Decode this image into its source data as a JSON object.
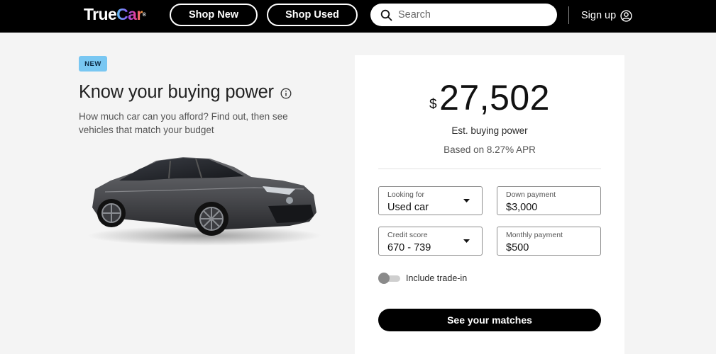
{
  "header": {
    "logo": {
      "part1": "True",
      "part2": "Car",
      "mark": "®"
    },
    "shop_new_label": "Shop New",
    "shop_used_label": "Shop Used",
    "search_placeholder": "Search",
    "sign_up_label": "Sign up",
    "icons": {
      "search": "search-icon",
      "account": "user-circle-icon"
    }
  },
  "hero": {
    "badge": "NEW",
    "title": "Know your buying power",
    "info_icon": "info-icon",
    "subtitle": "How much car can you afford? Find out, then see vehicles that match your budget",
    "image": "dark-gray-sedan-car-image"
  },
  "calculator": {
    "currency_symbol": "$",
    "amount": "27,502",
    "est_label": "Est. buying power",
    "apr_text": "Based on 8.27% APR",
    "fields": {
      "looking_for": {
        "label": "Looking for",
        "value": "Used car"
      },
      "down_payment": {
        "label": "Down payment",
        "value": "$3,000"
      },
      "credit_score": {
        "label": "Credit score",
        "value": "670 - 739"
      },
      "monthly_payment": {
        "label": "Monthly payment",
        "value": "$500"
      }
    },
    "trade_in": {
      "label": "Include trade-in",
      "enabled": false
    },
    "cta_label": "See your matches"
  },
  "colors": {
    "header_bg": "#000000",
    "page_bg": "#f4f4f4",
    "card_bg": "#ffffff",
    "badge_bg": "#79c7f2",
    "cta_bg": "#000000",
    "brand_gradient": [
      "#5fc6ef",
      "#8a5cf6",
      "#ef3b8f",
      "#f6a23a"
    ]
  }
}
